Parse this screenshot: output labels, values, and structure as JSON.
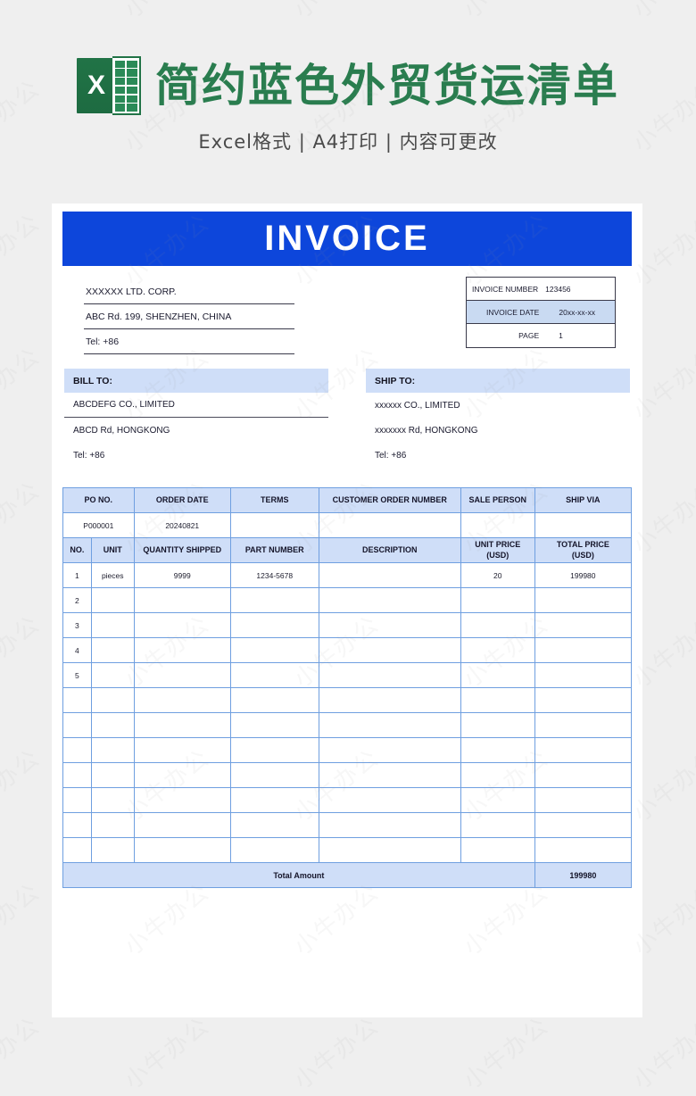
{
  "banner": {
    "icon": "excel-file-icon",
    "icon_letter": "X",
    "title": "简约蓝色外贸货运清单",
    "subtitle": "Excel格式 | A4打印 | 内容可更改"
  },
  "colors": {
    "page_background": "#efefef",
    "accent_blue": "#0d46db",
    "header_fill": "#cfdef8",
    "grid_line": "#6f9fe0",
    "brand_green": "#2a7d4f"
  },
  "invoice": {
    "heading": "INVOICE",
    "company": [
      "XXXXXX LTD. CORP.",
      "ABC Rd. 199, SHENZHEN, CHINA",
      "Tel: +86"
    ],
    "meta": [
      {
        "label": "INVOICE NUMBER",
        "value": "123456",
        "shaded": false
      },
      {
        "label": "INVOICE DATE",
        "value": "20xx-xx-xx",
        "shaded": true
      },
      {
        "label": "PAGE",
        "value": "1",
        "shaded": false
      }
    ],
    "bill_to": {
      "heading": "BILL TO:",
      "lines": [
        "ABCDEFG CO., LIMITED",
        "ABCD Rd, HONGKONG",
        "Tel: +86"
      ]
    },
    "ship_to": {
      "heading": "SHIP TO:",
      "lines": [
        "xxxxxx CO., LIMITED",
        "xxxxxxx Rd, HONGKONG",
        "Tel: +86"
      ]
    },
    "order_header": [
      "PO NO.",
      "ORDER DATE",
      "TERMS",
      "CUSTOMER ORDER NUMBER",
      "SALE PERSON",
      "SHIP VIA"
    ],
    "order_row": [
      "P000001",
      "20240821",
      "",
      "",
      "",
      ""
    ],
    "item_header": [
      "NO.",
      "UNIT",
      "QUANTITY SHIPPED",
      "PART NUMBER",
      "DESCRIPTION",
      "UNIT PRICE\n(USD)",
      "TOTAL PRICE\n(USD)"
    ],
    "item_header_unit_price_l1": "UNIT PRICE",
    "item_header_unit_price_l2": "(USD)",
    "item_header_total_price_l1": "TOTAL PRICE",
    "item_header_total_price_l2": "(USD)",
    "items": [
      {
        "no": "1",
        "unit": "pieces",
        "qty": "9999",
        "part": "1234-5678",
        "desc": "",
        "unit_price": "20",
        "total_price": "199980"
      },
      {
        "no": "2",
        "unit": "",
        "qty": "",
        "part": "",
        "desc": "",
        "unit_price": "",
        "total_price": ""
      },
      {
        "no": "3",
        "unit": "",
        "qty": "",
        "part": "",
        "desc": "",
        "unit_price": "",
        "total_price": ""
      },
      {
        "no": "4",
        "unit": "",
        "qty": "",
        "part": "",
        "desc": "",
        "unit_price": "",
        "total_price": ""
      },
      {
        "no": "5",
        "unit": "",
        "qty": "",
        "part": "",
        "desc": "",
        "unit_price": "",
        "total_price": ""
      },
      {
        "no": "",
        "unit": "",
        "qty": "",
        "part": "",
        "desc": "",
        "unit_price": "",
        "total_price": ""
      },
      {
        "no": "",
        "unit": "",
        "qty": "",
        "part": "",
        "desc": "",
        "unit_price": "",
        "total_price": ""
      },
      {
        "no": "",
        "unit": "",
        "qty": "",
        "part": "",
        "desc": "",
        "unit_price": "",
        "total_price": ""
      },
      {
        "no": "",
        "unit": "",
        "qty": "",
        "part": "",
        "desc": "",
        "unit_price": "",
        "total_price": ""
      },
      {
        "no": "",
        "unit": "",
        "qty": "",
        "part": "",
        "desc": "",
        "unit_price": "",
        "total_price": ""
      },
      {
        "no": "",
        "unit": "",
        "qty": "",
        "part": "",
        "desc": "",
        "unit_price": "",
        "total_price": ""
      },
      {
        "no": "",
        "unit": "",
        "qty": "",
        "part": "",
        "desc": "",
        "unit_price": "",
        "total_price": ""
      }
    ],
    "total_label": "Total Amount",
    "total_value": "199980"
  },
  "watermark": {
    "text": "小牛办公"
  }
}
